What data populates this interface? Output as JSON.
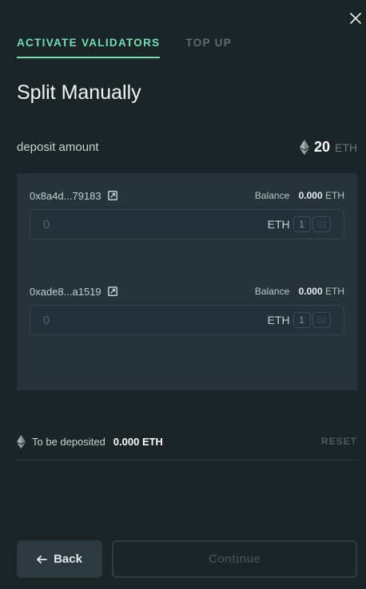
{
  "tabs": [
    {
      "label": "ACTIVATE VALIDATORS",
      "active": true
    },
    {
      "label": "TOP UP",
      "active": false
    }
  ],
  "title": "Split Manually",
  "deposit": {
    "label": "deposit amount",
    "amount": "20",
    "unit": "ETH"
  },
  "validators": [
    {
      "address": "0x8a4d...79183",
      "balance_label": "Balance",
      "balance_value": "0.000",
      "balance_unit": "ETH",
      "input_placeholder": "0",
      "input_unit": "ETH",
      "chip_one": "1",
      "chip_max": "32"
    },
    {
      "address": "0xade8...a1519",
      "balance_label": "Balance",
      "balance_value": "0.000",
      "balance_unit": "ETH",
      "input_placeholder": "0",
      "input_unit": "ETH",
      "chip_one": "1",
      "chip_max": "32"
    }
  ],
  "to_be_deposited": {
    "label": "To be deposited",
    "value": "0.000 ETH",
    "reset": "RESET"
  },
  "buttons": {
    "back": "Back",
    "continue": "Continue"
  },
  "icons": {
    "close": "close-icon",
    "eth": "eth-icon",
    "edit": "external-edit-icon",
    "back_arrow": "arrow-left-icon"
  },
  "colors": {
    "accent": "#6fe0b4",
    "background": "#1b2527",
    "panel": "#25343a"
  }
}
